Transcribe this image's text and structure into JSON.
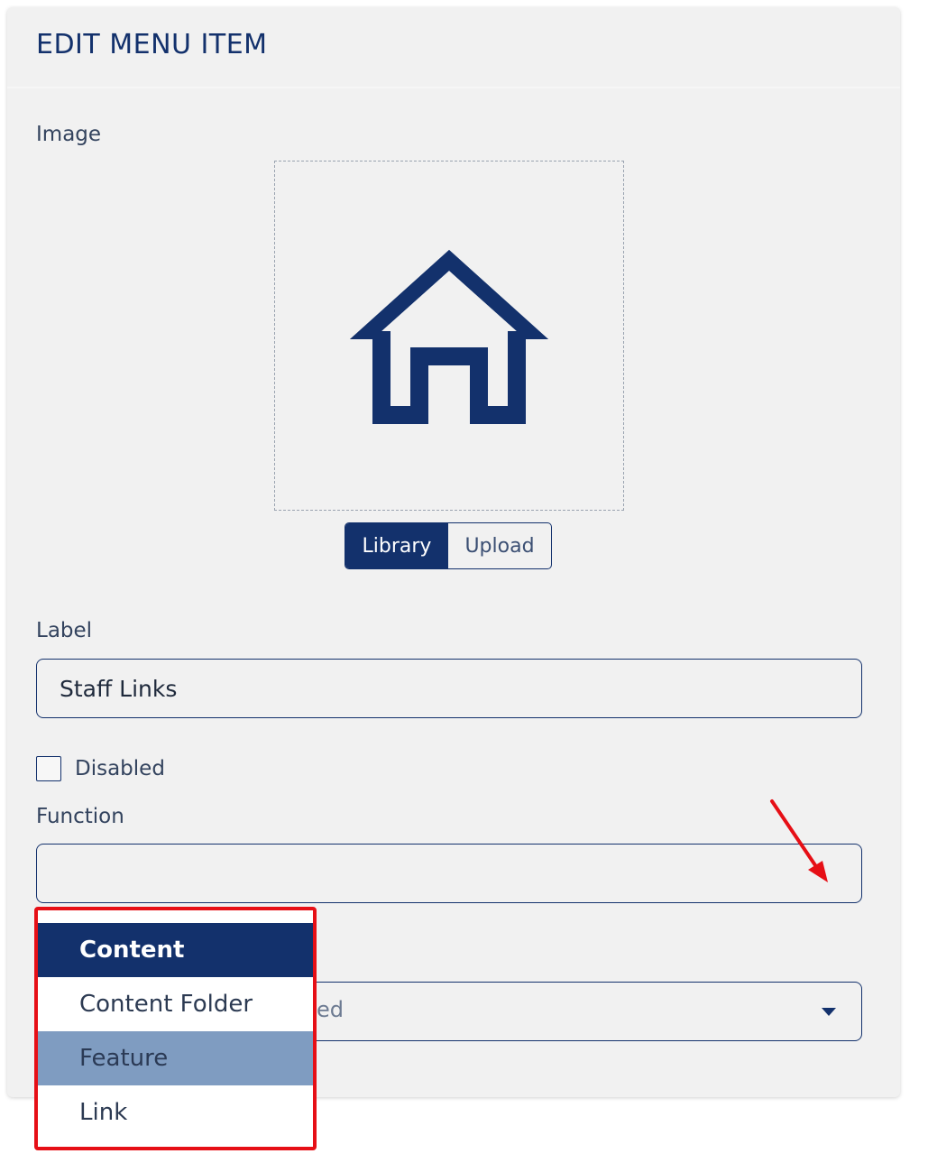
{
  "card": {
    "title": "EDIT MENU ITEM"
  },
  "image_field": {
    "label": "Image",
    "icon": "home-icon",
    "icon_color": "#13316c",
    "source_buttons": [
      {
        "label": "Library",
        "active": true
      },
      {
        "label": "Upload",
        "active": false
      }
    ]
  },
  "label_field": {
    "label": "Label",
    "value": "Staff Links"
  },
  "disabled_checkbox": {
    "label": "Disabled",
    "checked": false
  },
  "function_field": {
    "label": "Function",
    "value": ""
  },
  "second_select": {
    "visible_text": "ed"
  },
  "function_dropdown": {
    "options": [
      {
        "label": "Content",
        "state": "selected"
      },
      {
        "label": "Content Folder",
        "state": "normal"
      },
      {
        "label": "Feature",
        "state": "hover"
      },
      {
        "label": "Link",
        "state": "normal"
      }
    ]
  },
  "annotation": {
    "highlight_color": "#e60f16",
    "arrow_color": "#e60f16"
  },
  "colors": {
    "primary": "#13316c",
    "card_background": "#f1f1f1",
    "hover": "#7f9cc1"
  }
}
